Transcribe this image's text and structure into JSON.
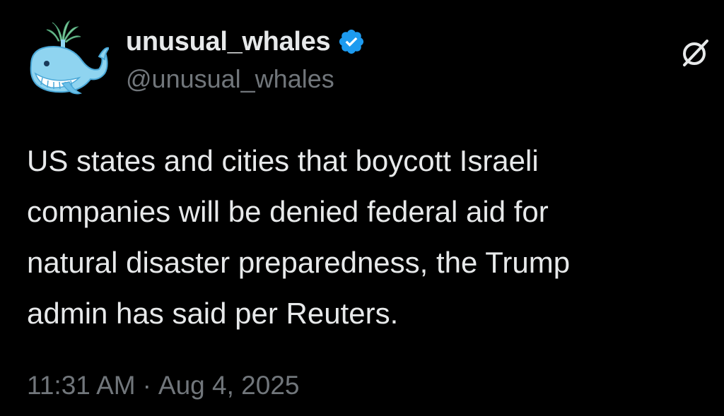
{
  "author": {
    "display_name": "unusual_whales",
    "handle": "@unusual_whales",
    "avatar_icon": "whale-logo-icon",
    "verified_icon": "verified-badge-icon",
    "verified_color": "#1d9bf0"
  },
  "actions": {
    "grok_icon": "grok-icon"
  },
  "post": {
    "text": "US states and cities that boycott Israeli\ncompanies will be denied federal aid for\nnatural disaster preparedness, the Trump\nadmin has said per Reuters."
  },
  "meta": {
    "time": "11:31 AM",
    "separator": "·",
    "date": "Aug 4, 2025"
  },
  "colors": {
    "background": "#000000",
    "primary_text": "#e7e9ea",
    "secondary_text": "#71767b"
  }
}
